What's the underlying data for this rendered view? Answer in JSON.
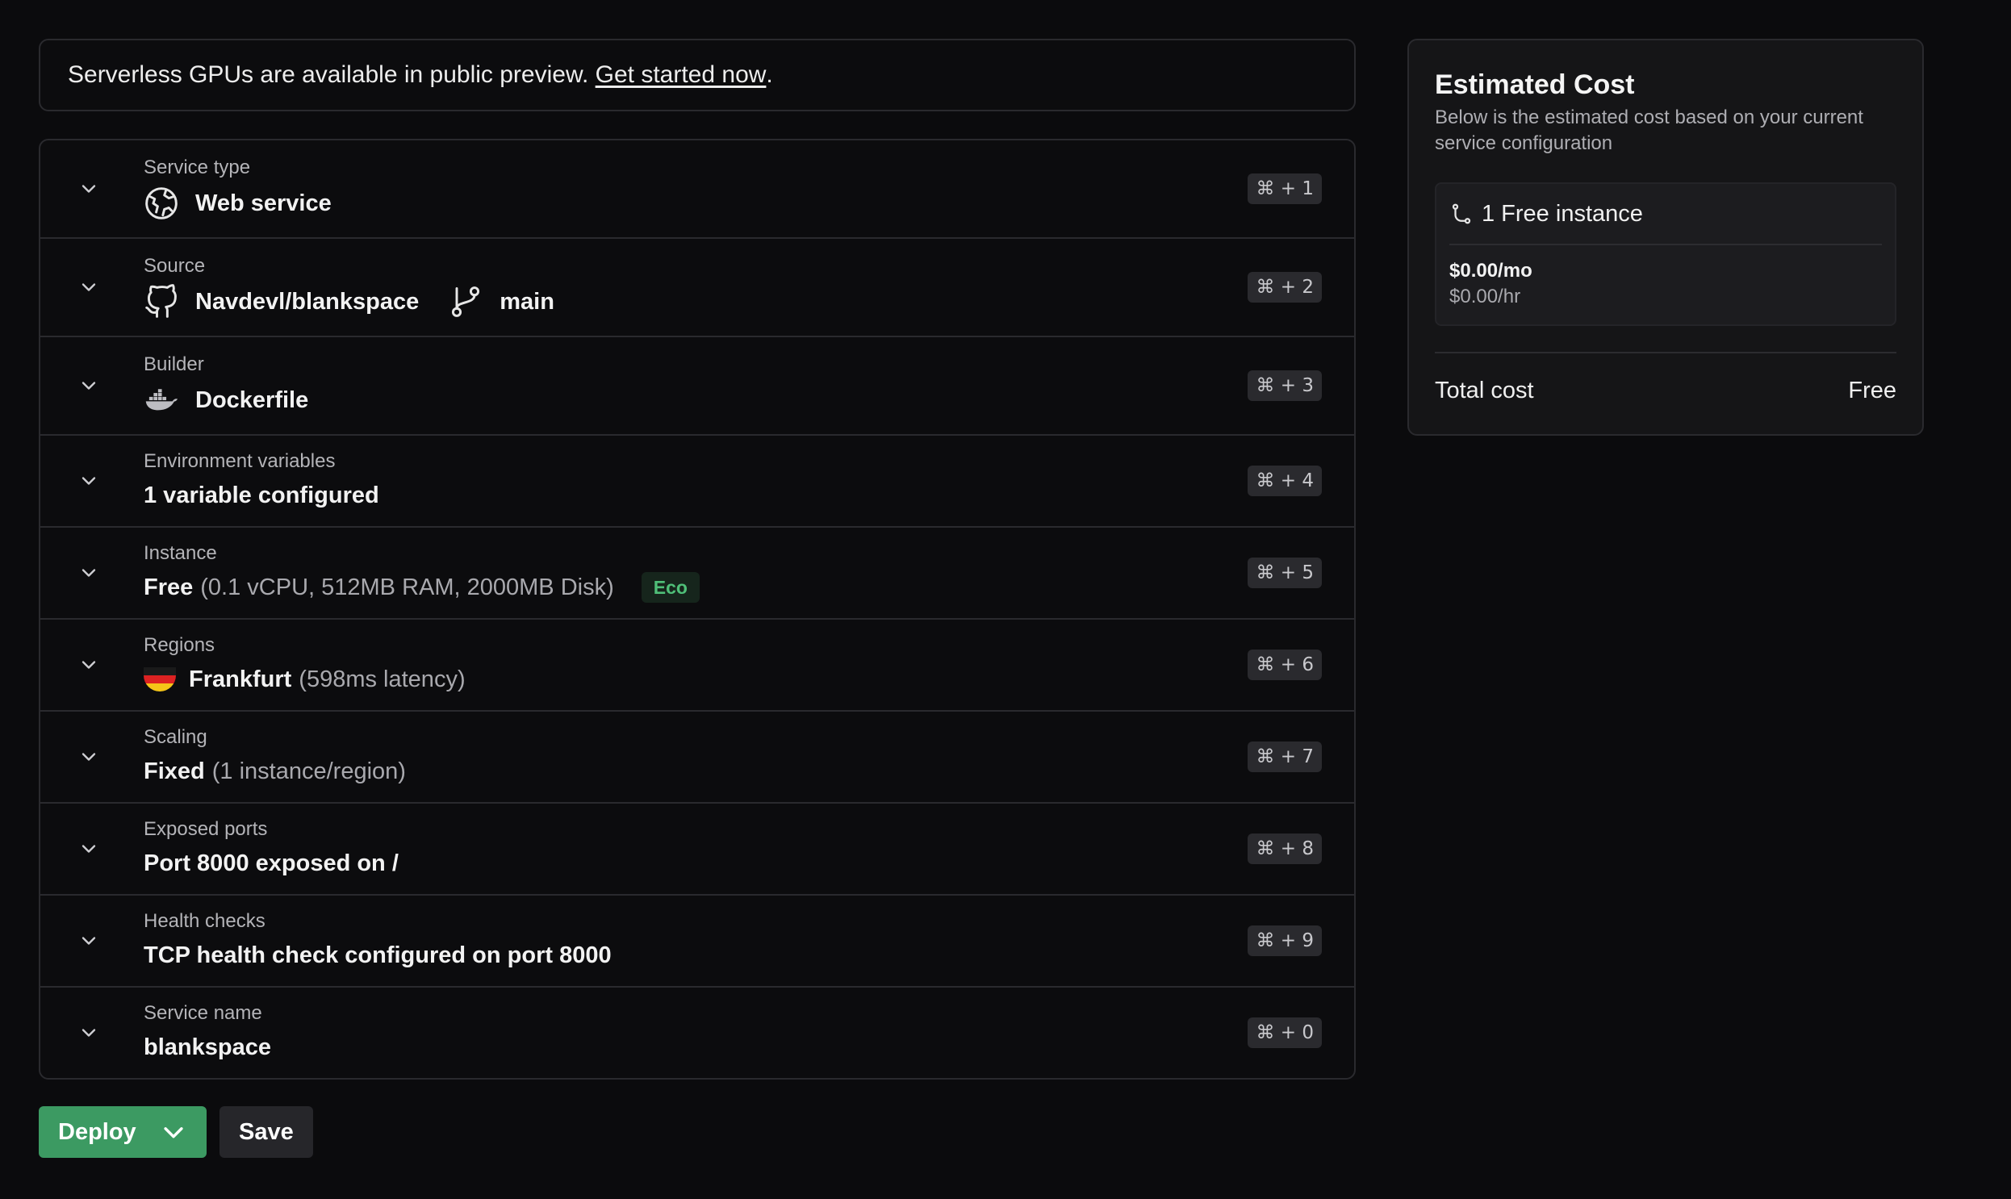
{
  "banner": {
    "text": "Serverless GPUs are available in public preview. ",
    "link": "Get started now",
    "suffix": "."
  },
  "sections": [
    {
      "label": "Service type",
      "value": "Web service",
      "shortcut": "⌘ + 1",
      "icon": "globe-icon"
    },
    {
      "label": "Source",
      "value": "Navdevl/blankspace",
      "branch": "main",
      "shortcut": "⌘ + 2",
      "icon": "github-icon",
      "branch_icon": "git-branch-icon"
    },
    {
      "label": "Builder",
      "value": "Dockerfile",
      "shortcut": "⌘ + 3",
      "icon": "docker-icon"
    },
    {
      "label": "Environment variables",
      "value": "1 variable configured",
      "shortcut": "⌘ + 4"
    },
    {
      "label": "Instance",
      "value": "Free",
      "detail": "(0.1 vCPU, 512MB RAM, 2000MB Disk)",
      "badge": "Eco",
      "shortcut": "⌘ + 5"
    },
    {
      "label": "Regions",
      "value": "Frankfurt",
      "detail": "(598ms latency)",
      "shortcut": "⌘ + 6",
      "icon": "germany-flag-icon"
    },
    {
      "label": "Scaling",
      "value": "Fixed",
      "detail": "(1 instance/region)",
      "shortcut": "⌘ + 7"
    },
    {
      "label": "Exposed ports",
      "value": "Port 8000 exposed on /",
      "shortcut": "⌘ + 8"
    },
    {
      "label": "Health checks",
      "value": "TCP health check configured on port 8000",
      "shortcut": "⌘ + 9"
    },
    {
      "label": "Service name",
      "value": "blankspace",
      "shortcut": "⌘ + 0"
    }
  ],
  "actions": {
    "deploy_label": "Deploy",
    "save_label": "Save"
  },
  "cost": {
    "title": "Estimated Cost",
    "subtitle": "Below is the estimated cost based on your current service configuration",
    "instance_label": "1 Free instance",
    "monthly": "$0.00/mo",
    "hourly": "$0.00/hr",
    "total_label": "Total cost",
    "total_value": "Free"
  },
  "colors": {
    "background": "#0b0b0d",
    "accent_green": "#3c9a62",
    "eco_badge": "#4fbf78"
  }
}
